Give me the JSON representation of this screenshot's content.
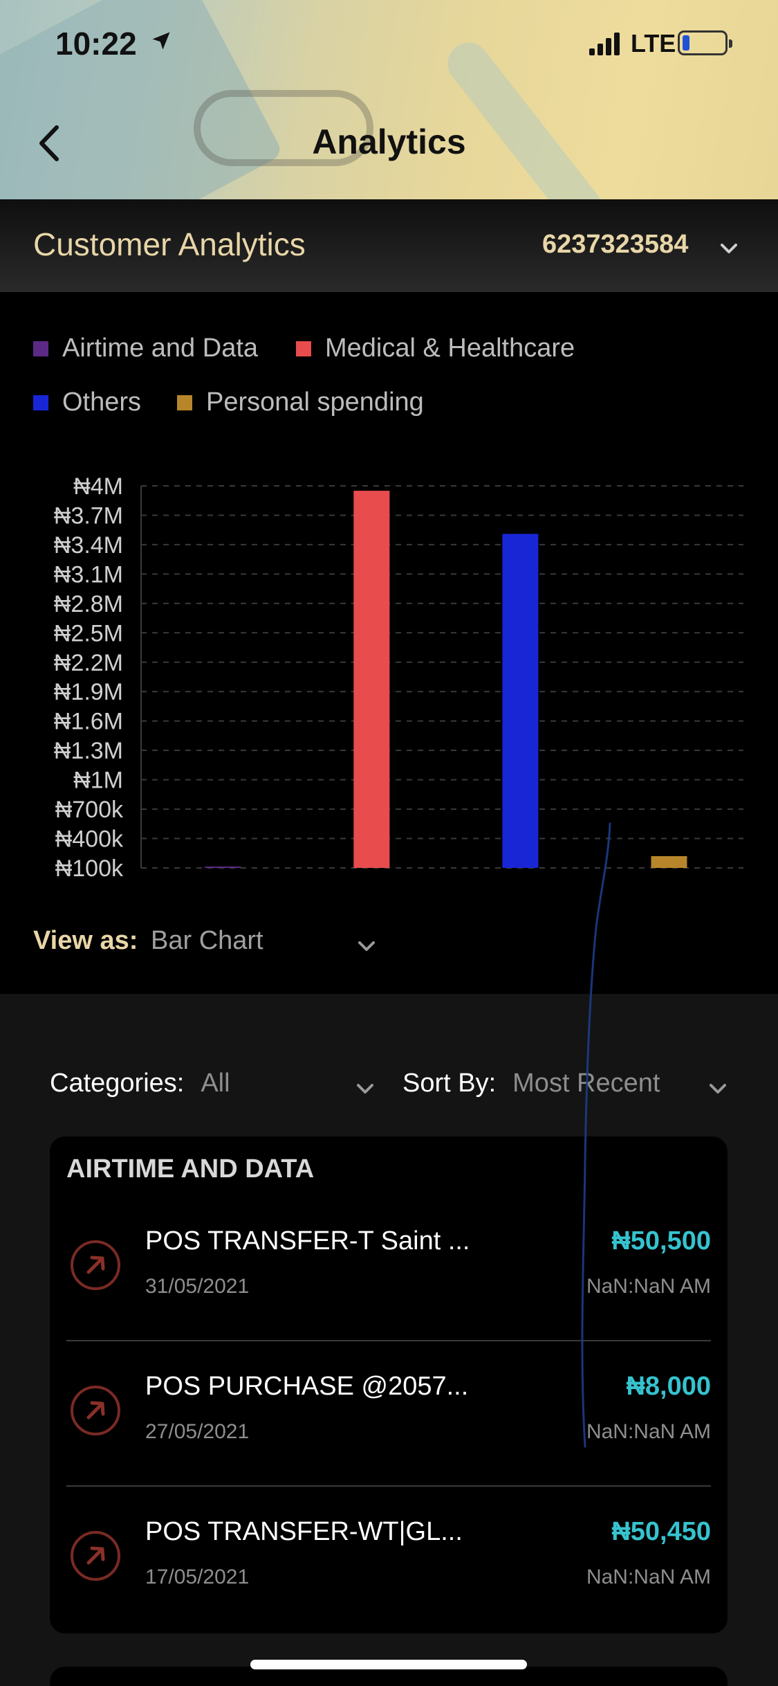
{
  "status_bar": {
    "time": "10:22",
    "network": "LTE"
  },
  "nav": {
    "title": "Analytics"
  },
  "customer": {
    "title": "Customer Analytics",
    "account_number": "6237323584"
  },
  "legend": [
    {
      "label": "Airtime and Data",
      "color": "#5b2a86"
    },
    {
      "label": "Medical & Healthcare",
      "color": "#e84c4d"
    },
    {
      "label": "Others",
      "color": "#1826d6"
    },
    {
      "label": "Personal spending",
      "color": "#b8862a"
    }
  ],
  "chart_data": {
    "type": "bar",
    "categories": [
      "Airtime and Data",
      "Medical & Healthcare",
      "Others",
      "Personal spending"
    ],
    "values": [
      108500,
      3950000,
      3510000,
      220000
    ],
    "colors": [
      "#5b2a86",
      "#e84c4d",
      "#1826d6",
      "#b8862a"
    ],
    "ylim": [
      100000,
      4000000
    ],
    "ytick_values": [
      100000,
      400000,
      700000,
      1000000,
      1300000,
      1600000,
      1900000,
      2200000,
      2500000,
      2800000,
      3100000,
      3400000,
      3700000,
      4000000
    ],
    "ytick_labels": [
      "₦100k",
      "₦400k",
      "₦700k",
      "₦1M",
      "₦1.3M",
      "₦1.6M",
      "₦1.9M",
      "₦2.2M",
      "₦2.5M",
      "₦2.8M",
      "₦3.1M",
      "₦3.4M",
      "₦3.7M",
      "₦4M"
    ],
    "grid": true
  },
  "view_as": {
    "label": "View as:",
    "value": "Bar Chart"
  },
  "filters": {
    "categories_label": "Categories:",
    "categories_value": "All",
    "sort_label": "Sort By:",
    "sort_value": "Most Recent"
  },
  "card": {
    "title": "AIRTIME AND DATA",
    "transactions": [
      {
        "name": "POS TRANSFER-T Saint ...",
        "date": "31/05/2021",
        "amount": "₦50,500",
        "time": "NaN:NaN AM"
      },
      {
        "name": "POS PURCHASE @2057...",
        "date": "27/05/2021",
        "amount": "₦8,000",
        "time": "NaN:NaN AM"
      },
      {
        "name": "POS TRANSFER-WT|GL...",
        "date": "17/05/2021",
        "amount": "₦50,450",
        "time": "NaN:NaN AM"
      }
    ]
  }
}
